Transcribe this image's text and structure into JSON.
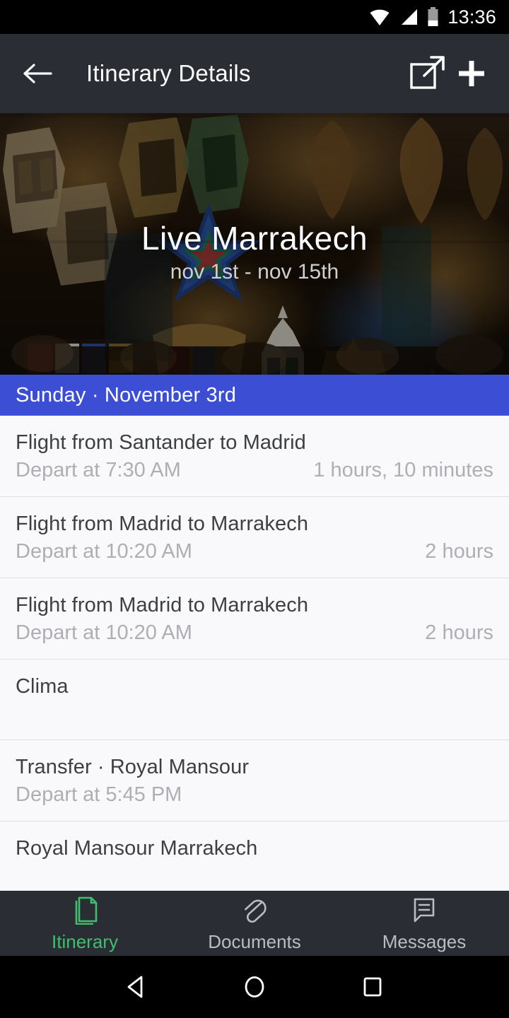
{
  "status_bar": {
    "time": "13:36",
    "icons": [
      "wifi-icon",
      "cellular-signal-icon",
      "battery-icon"
    ]
  },
  "app_bar": {
    "back_label": "back-arrow",
    "title": "Itinerary Details",
    "share_label": "open-external",
    "add_label": "add"
  },
  "hero": {
    "title": "Live Marrakech",
    "subtitle": "nov 1st - nov 15th",
    "image_description": "moroccan-lantern-souk"
  },
  "date_header": {
    "label": "Sunday · November 3rd",
    "color": "#3B4ED4"
  },
  "items": [
    {
      "title": "Flight from Santander to Madrid",
      "subtitle": "Depart at 7:30 AM",
      "duration": "1 hours, 10 minutes"
    },
    {
      "title": "Flight from Madrid to Marrakech",
      "subtitle": "Depart at 10:20 AM",
      "duration": "2 hours"
    },
    {
      "title": "Flight from Madrid to Marrakech",
      "subtitle": "Depart at 10:20 AM",
      "duration": "2 hours"
    },
    {
      "title": "Clima",
      "subtitle": "",
      "duration": ""
    },
    {
      "title": "Transfer · Royal Mansour",
      "subtitle": "Depart at 5:45 PM",
      "duration": ""
    },
    {
      "title": "Royal Mansour Marrakech",
      "subtitle": "",
      "duration": ""
    }
  ],
  "tabs": [
    {
      "label": "Itinerary",
      "icon": "document-icon",
      "active": true
    },
    {
      "label": "Documents",
      "icon": "paperclip-icon",
      "active": false
    },
    {
      "label": "Messages",
      "icon": "chat-bubble-icon",
      "active": false
    }
  ],
  "tab_active_color": "#3EBF6C",
  "tab_inactive_color": "#B9BCC0",
  "system_nav": {
    "back": "back-triangle",
    "home": "home-circle",
    "recents": "recents-square"
  }
}
